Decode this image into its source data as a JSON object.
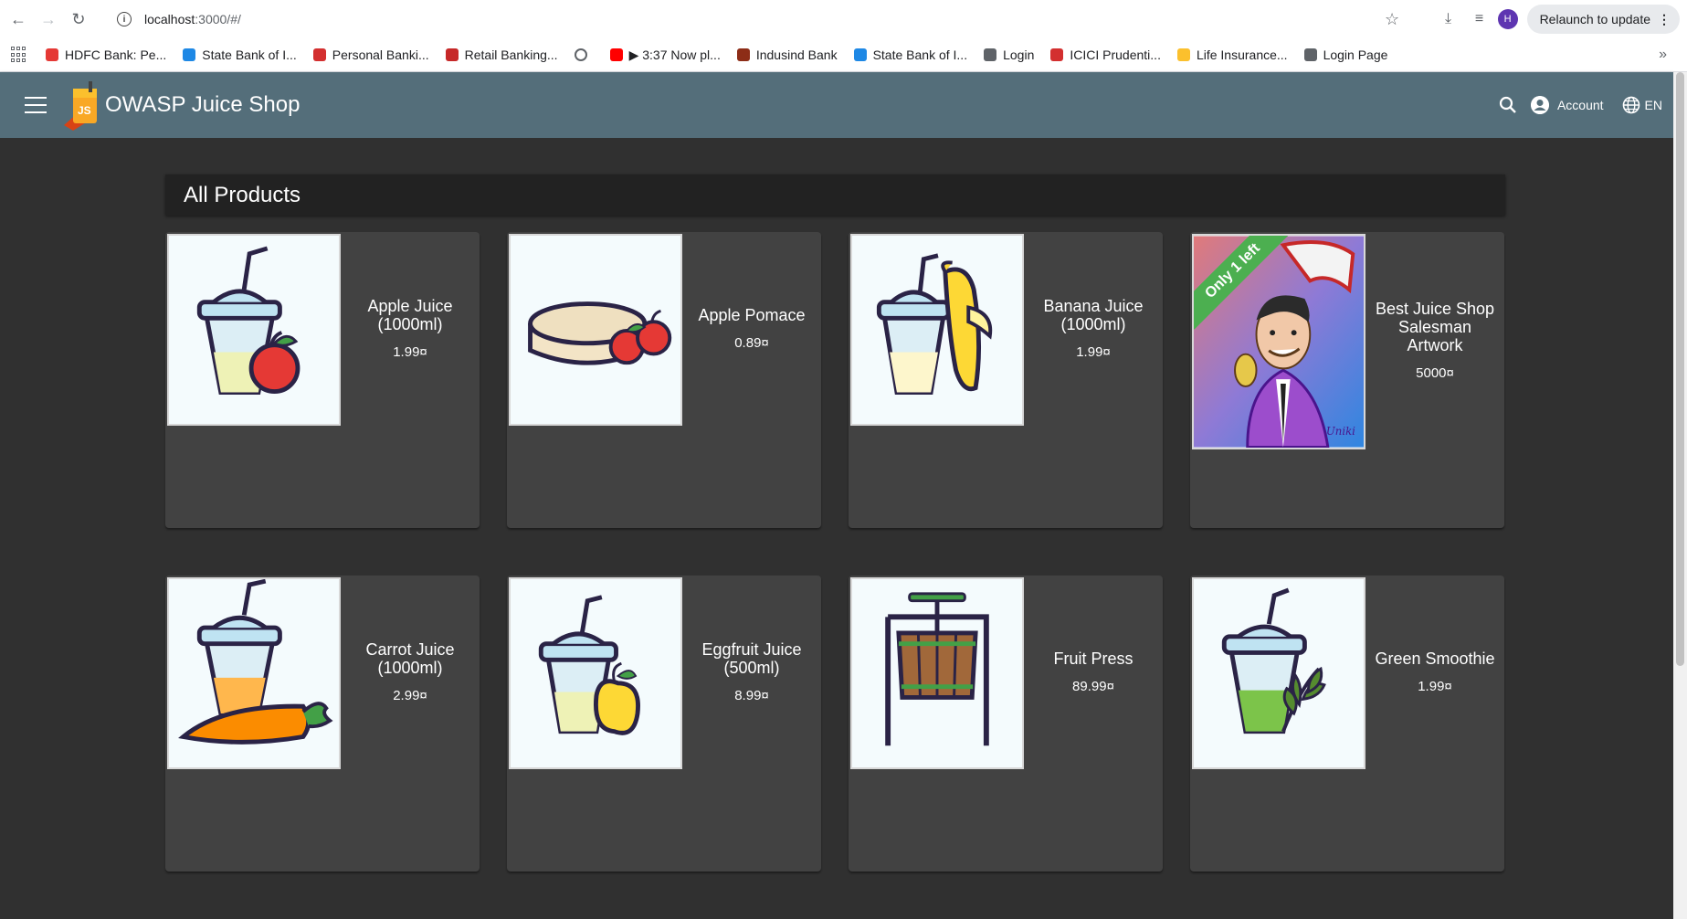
{
  "browser": {
    "url_host": "localhost",
    "url_rest": ":3000/#/",
    "profile_initial": "H",
    "relaunch_label": "Relaunch to update",
    "bookmarks": [
      {
        "label": "HDFC Bank: Pe...",
        "color": "#e53935"
      },
      {
        "label": "State Bank of I...",
        "color": "#1e88e5"
      },
      {
        "label": "Personal Banki...",
        "color": "#d32f2f"
      },
      {
        "label": "Retail Banking...",
        "color": "#c62828"
      },
      {
        "label": "",
        "color": "#5f6368"
      },
      {
        "label": "▶ 3:37 Now pl...",
        "color": "#ff0000"
      },
      {
        "label": "Indusind Bank",
        "color": "#8d2d17"
      },
      {
        "label": "State Bank of I...",
        "color": "#1e88e5"
      },
      {
        "label": "Login",
        "color": "#5f6368"
      },
      {
        "label": "ICICI Prudenti...",
        "color": "#d32f2f"
      },
      {
        "label": "Life Insurance...",
        "color": "#fbc02d"
      },
      {
        "label": "Login Page",
        "color": "#5f6368"
      }
    ]
  },
  "app": {
    "title": "OWASP Juice Shop",
    "account_label": "Account",
    "language_label": "EN",
    "colors": {
      "toolbar": "#546e7a",
      "background": "#303030",
      "card": "#424242",
      "ribbon": "#4caf50"
    }
  },
  "main": {
    "heading": "All Products",
    "products": [
      {
        "name": "Apple Juice (1000ml)",
        "price": "1.99¤",
        "icon": "apple-juice-icon"
      },
      {
        "name": "Apple Pomace",
        "price": "0.89¤",
        "icon": "apple-pomace-icon"
      },
      {
        "name": "Banana Juice (1000ml)",
        "price": "1.99¤",
        "icon": "banana-juice-icon"
      },
      {
        "name": "Best Juice Shop Salesman Artwork",
        "price": "5000¤",
        "icon": "salesman-artwork-image",
        "ribbon": "Only 1 left"
      },
      {
        "name": "Carrot Juice (1000ml)",
        "price": "2.99¤",
        "icon": "carrot-juice-icon"
      },
      {
        "name": "Eggfruit Juice (500ml)",
        "price": "8.99¤",
        "icon": "eggfruit-juice-icon"
      },
      {
        "name": "Fruit Press",
        "price": "89.99¤",
        "icon": "fruit-press-icon"
      },
      {
        "name": "Green Smoothie",
        "price": "1.99¤",
        "icon": "green-smoothie-icon"
      }
    ]
  }
}
